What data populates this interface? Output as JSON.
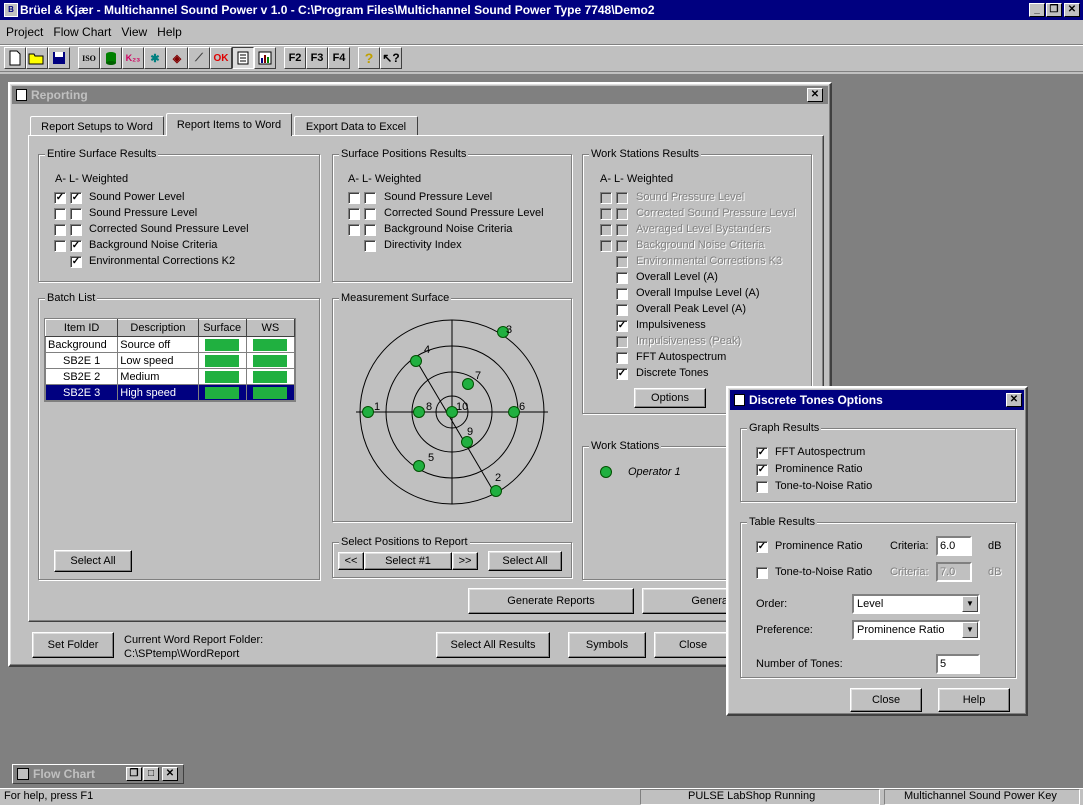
{
  "app": {
    "title": "Brüel & Kjær - Multichannel Sound Power v 1.0 - C:\\Program Files\\Multichannel Sound Power Type 7748\\Demo2",
    "menu": [
      "Project",
      "Flow Chart",
      "View",
      "Help"
    ],
    "toolbar": [
      "new-icon",
      "open-icon",
      "save-icon",
      "iso-icon",
      "db-icon",
      "k23-icon",
      "tools-icon",
      "display-icon",
      "calibrate-icon",
      "ok-icon",
      "report-icon",
      "chart-icon",
      "F2",
      "F3",
      "F4",
      "help-icon",
      "whatsthis-icon"
    ],
    "toolbar_text": {
      "iso": "ISO",
      "k23": "K₂₃",
      "f2": "F2",
      "f3": "F3",
      "f4": "F4"
    }
  },
  "reporting": {
    "title": "Reporting",
    "tabs": [
      "Report Setups to Word",
      "Report Items to Word",
      "Export Data to Excel"
    ],
    "entire_surface": {
      "title": "Entire Surface Results",
      "header": "A-  L-  Weighted",
      "items": [
        {
          "label": "Sound Power Level",
          "a": true,
          "l": true
        },
        {
          "label": "Sound Pressure Level",
          "a": false,
          "l": false
        },
        {
          "label": "Corrected Sound Pressure Level",
          "a": false,
          "l": false
        },
        {
          "label": "Background Noise Criteria",
          "a": false,
          "l": true
        },
        {
          "label": "Environmental Corrections K2",
          "single": true
        }
      ]
    },
    "surface_positions": {
      "title": "Surface Positions Results",
      "header": "A-  L-  Weighted",
      "items": [
        "Sound Pressure Level",
        "Corrected Sound Pressure Level",
        "Background Noise Criteria",
        "Directivity Index"
      ]
    },
    "work_stations_results": {
      "title": "Work Stations Results",
      "header": "A-  L-  Weighted",
      "items": [
        {
          "label": "Sound Pressure Level",
          "disabled": true
        },
        {
          "label": "Corrected Sound Pressure Level",
          "disabled": true
        },
        {
          "label": "Averaged Level Bystanders",
          "disabled": true
        },
        {
          "label": "Background Noise Criteria",
          "disabled": true
        },
        {
          "label": "Environmental Corrections K3",
          "disabled": true
        },
        {
          "label": "Overall Level (A)",
          "checked": false
        },
        {
          "label": "Overall Impulse Level (A)",
          "checked": false
        },
        {
          "label": "Overall Peak Level (A)",
          "checked": false
        },
        {
          "label": "Impulsiveness",
          "checked": true
        },
        {
          "label": "Impulsiveness (Peak)",
          "disabled": true
        },
        {
          "label": "FFT Autospectrum",
          "checked": false
        },
        {
          "label": "Discrete Tones",
          "checked": true
        }
      ],
      "options_label": "Options"
    },
    "batch_list": {
      "title": "Batch List",
      "columns": [
        "Item ID",
        "Description",
        "Surface",
        "WS"
      ],
      "rows": [
        {
          "id": "Background",
          "desc": "Source off"
        },
        {
          "id": "SB2E 1",
          "desc": "Low speed"
        },
        {
          "id": "SB2E 2",
          "desc": "Medium"
        },
        {
          "id": "SB2E 3",
          "desc": "High speed"
        }
      ],
      "select_all": "Select All"
    },
    "measurement_surface": {
      "title": "Measurement Surface",
      "positions": [
        "1",
        "2",
        "3",
        "4",
        "5",
        "6",
        "7",
        "8",
        "9",
        "10"
      ]
    },
    "select_positions": {
      "title": "Select Positions to Report",
      "prev": "<<",
      "select": "Select #1",
      "next": ">>",
      "select_all": "Select All"
    },
    "work_stations": {
      "title": "Work Stations",
      "operator": "Operator 1"
    },
    "generate_reports": "Generate Reports",
    "generate_and": "Generate and",
    "set_folder": "Set Folder",
    "folder_caption": "Current Word Report Folder:",
    "folder_path": "C:\\SPtemp\\WordReport",
    "select_all_results": "Select All Results",
    "symbols": "Symbols",
    "close": "Close"
  },
  "dialog": {
    "title": "Discrete Tones Options",
    "graph_title": "Graph Results",
    "graph": [
      {
        "label": "FFT Autospectrum",
        "checked": true
      },
      {
        "label": "Prominence Ratio",
        "checked": true
      },
      {
        "label": "Tone-to-Noise Ratio",
        "checked": false
      }
    ],
    "table_title": "Table Results",
    "prominence_label": "Prominence Ratio",
    "tnr_label": "Tone-to-Noise Ratio",
    "criteria_label": "Criteria:",
    "prominence_criteria": "6.0",
    "tnr_criteria": "7.0",
    "unit": "dB",
    "order_label": "Order:",
    "order_value": "Level",
    "preference_label": "Preference:",
    "preference_value": "Prominence Ratio",
    "tones_label": "Number of Tones:",
    "tones_value": "5",
    "close": "Close",
    "help": "Help"
  },
  "flowchart": {
    "title": "Flow Chart"
  },
  "status": {
    "help": "For help, press F1",
    "pulse": "PULSE LabShop Running",
    "key": "Multichannel Sound Power Key"
  }
}
